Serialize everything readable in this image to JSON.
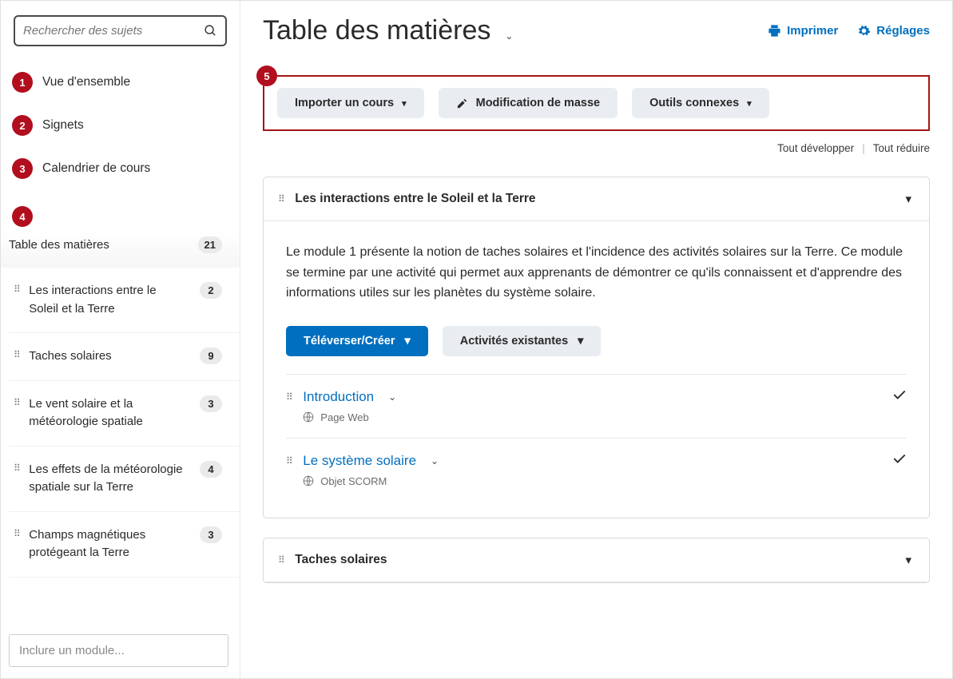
{
  "sidebar": {
    "search_placeholder": "Rechercher des sujets",
    "nav": [
      {
        "callout": "1",
        "label": "Vue d'ensemble"
      },
      {
        "callout": "2",
        "label": "Signets"
      },
      {
        "callout": "3",
        "label": "Calendrier de cours"
      }
    ],
    "toc": {
      "callout": "4",
      "label": "Table des matières",
      "count": "21"
    },
    "modules": [
      {
        "title": "Les interactions entre le Soleil et la Terre",
        "count": "2"
      },
      {
        "title": "Taches solaires",
        "count": "9"
      },
      {
        "title": "Le vent solaire et la météorologie spatiale",
        "count": "3"
      },
      {
        "title": "Les effets de la météorologie spatiale sur la Terre",
        "count": "4"
      },
      {
        "title": "Champs magnétiques protégeant la Terre",
        "count": "3"
      }
    ],
    "include_placeholder": "Inclure un module..."
  },
  "header": {
    "title": "Table des matières",
    "print": "Imprimer",
    "settings": "Réglages"
  },
  "toolbar": {
    "callout": "5",
    "import_course": "Importer un cours",
    "bulk_edit": "Modification de masse",
    "related_tools": "Outils connexes"
  },
  "expand": {
    "expand_all": "Tout développer",
    "collapse_all": "Tout réduire"
  },
  "module1": {
    "title": "Les interactions entre le Soleil et la Terre",
    "description": "Le module 1 présente la notion de taches solaires et l'incidence des activités solaires sur la Terre. Ce module se termine par une activité qui permet aux apprenants de démontrer ce qu'ils connaissent et d'apprendre des informations utiles sur les planètes du système solaire.",
    "upload_create": "Téléverser/Créer",
    "existing_activities": "Activités existantes",
    "topics": [
      {
        "title": "Introduction",
        "type": "Page Web"
      },
      {
        "title": "Le système solaire",
        "type": "Objet SCORM"
      }
    ]
  },
  "module2": {
    "title": "Taches solaires"
  }
}
